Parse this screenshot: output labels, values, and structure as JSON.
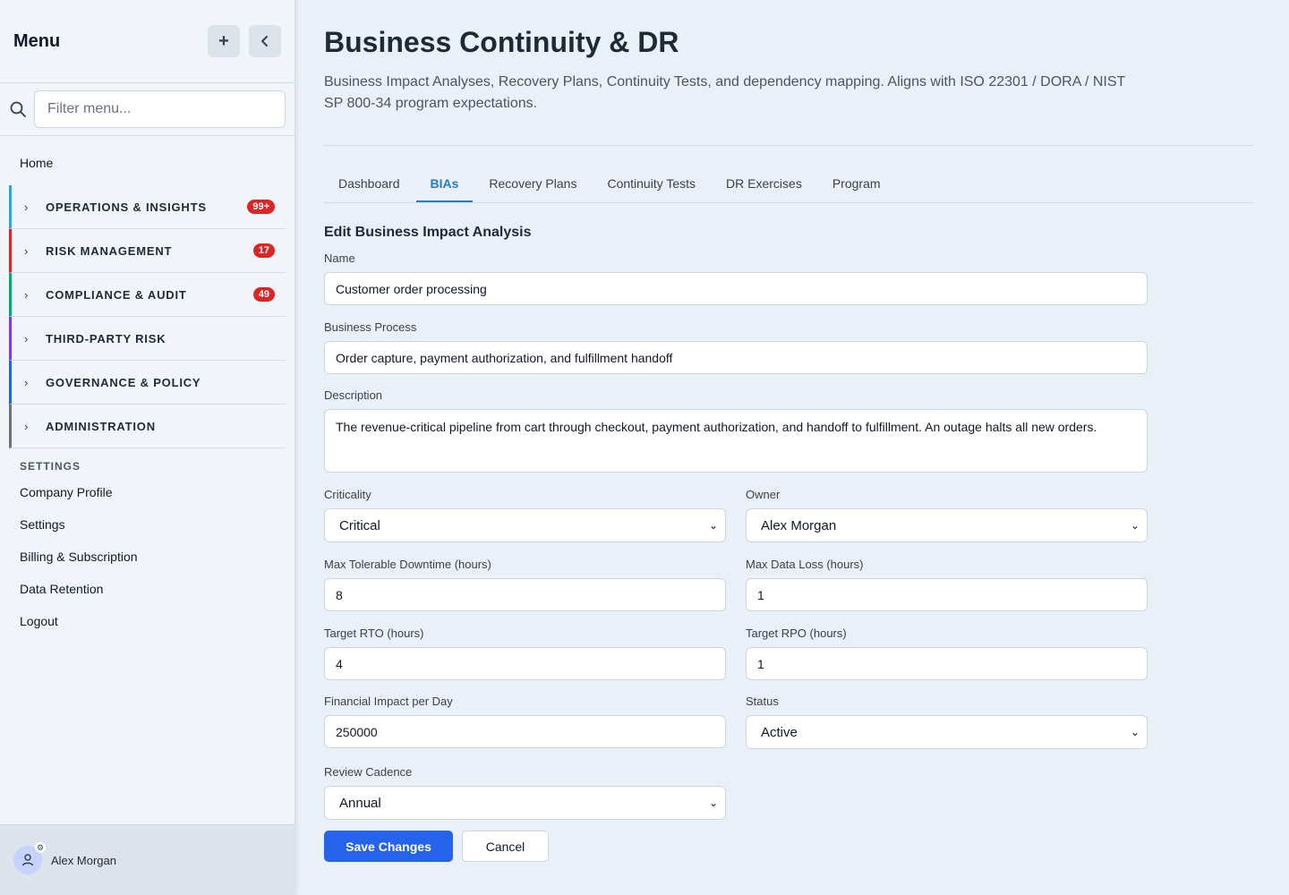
{
  "sidebar": {
    "title": "Menu",
    "add_icon": "plus-icon",
    "collapse_icon": "chevron-left-icon",
    "filter_placeholder": "Filter menu...",
    "home": "Home",
    "groups": [
      {
        "label": "OPERATIONS & INSIGHTS",
        "badge": "99+",
        "color": "#38a3d6"
      },
      {
        "label": "RISK MANAGEMENT",
        "badge": "17",
        "color": "#dc2626"
      },
      {
        "label": "COMPLIANCE & AUDIT",
        "badge": "49",
        "color": "#10a36a"
      },
      {
        "label": "THIRD-PARTY RISK",
        "badge": "",
        "color": "#7c3aed"
      },
      {
        "label": "GOVERNANCE & POLICY",
        "badge": "",
        "color": "#2563eb"
      },
      {
        "label": "ADMINISTRATION",
        "badge": "",
        "color": "#6b7280"
      }
    ],
    "settings_heading": "SETTINGS",
    "settings_links": [
      "Company Profile",
      "Settings",
      "Billing & Subscription",
      "Data Retention",
      "Logout"
    ],
    "user_name": "Alex Morgan"
  },
  "page": {
    "title": "Business Continuity & DR",
    "description": "Business Impact Analyses, Recovery Plans, Continuity Tests, and dependency mapping. Aligns with ISO 22301 / DORA / NIST SP 800-34 program expectations.",
    "tabs": [
      "Dashboard",
      "BIAs",
      "Recovery Plans",
      "Continuity Tests",
      "DR Exercises",
      "Program"
    ],
    "active_tab": "BIAs"
  },
  "form": {
    "title": "Edit Business Impact Analysis",
    "name_label": "Name",
    "name_value": "Customer order processing",
    "process_label": "Business Process",
    "process_value": "Order capture, payment authorization, and fulfillment handoff",
    "description_label": "Description",
    "description_value": "The revenue-critical pipeline from cart through checkout, payment authorization, and handoff to fulfillment. An outage halts all new orders.",
    "criticality_label": "Criticality",
    "criticality_value": "Critical",
    "owner_label": "Owner",
    "owner_value": "Alex Morgan",
    "mtd_label": "Max Tolerable Downtime (hours)",
    "mtd_value": "8",
    "mdl_label": "Max Data Loss (hours)",
    "mdl_value": "1",
    "rto_label": "Target RTO (hours)",
    "rto_value": "4",
    "rpo_label": "Target RPO (hours)",
    "rpo_value": "1",
    "financial_label": "Financial Impact per Day",
    "financial_value": "250000",
    "status_label": "Status",
    "status_value": "Active",
    "cadence_label": "Review Cadence",
    "cadence_value": "Annual",
    "save_label": "Save Changes",
    "cancel_label": "Cancel"
  },
  "colors": {
    "accent": "#2a7bc0",
    "primary_button": "#2563eb",
    "badge": "#dc2626"
  }
}
